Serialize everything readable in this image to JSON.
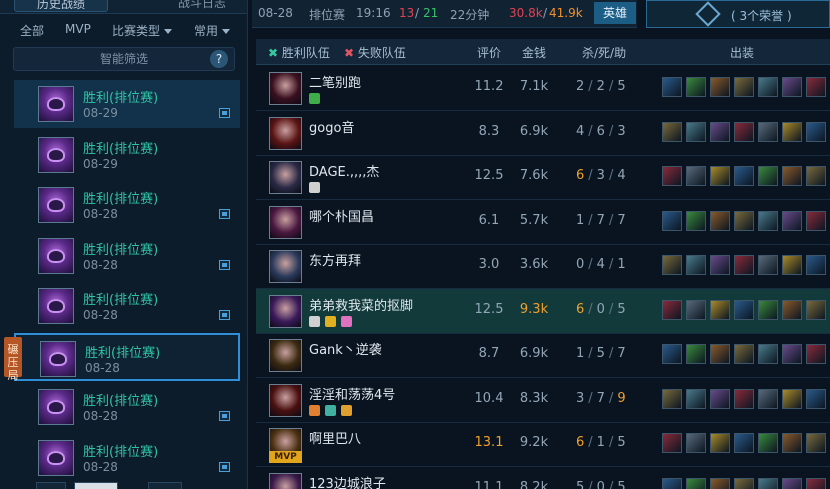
{
  "left": {
    "tab_active": "历史战绩",
    "tab_other": "战斗日志",
    "filters": [
      "全部",
      "MVP",
      "比赛类型",
      "常用"
    ],
    "smart_filter": "智能筛选",
    "help": "?",
    "crush_badge": "碾压局",
    "matches": [
      {
        "result": "胜利(排位赛)",
        "date": "08-29",
        "has_pic": true,
        "selected": true
      },
      {
        "result": "胜利(排位赛)",
        "date": "08-29",
        "has_pic": false
      },
      {
        "result": "胜利(排位赛)",
        "date": "08-28",
        "has_pic": true
      },
      {
        "result": "胜利(排位赛)",
        "date": "08-28",
        "has_pic": true
      },
      {
        "result": "胜利(排位赛)",
        "date": "08-28",
        "has_pic": true
      },
      {
        "result": "胜利(排位赛)",
        "date": "08-28",
        "has_pic": false,
        "highlighted": true
      },
      {
        "result": "胜利(排位赛)",
        "date": "08-28",
        "has_pic": true
      },
      {
        "result": "胜利(排位赛)",
        "date": "08-28",
        "has_pic": true
      }
    ]
  },
  "info": {
    "date": "08-28",
    "mode": "排位赛",
    "time": "19:16",
    "kills_red": "13",
    "slash": "/",
    "kills_green": "21",
    "duration": "22分钟",
    "gold_red": "30.8k",
    "gold_green": "41.9k",
    "hero_btn": "英雄",
    "honor": "( 3个荣誉 )"
  },
  "header": {
    "win_team": "胜利队伍",
    "lose_team": "失败队伍",
    "score": "评价",
    "gold": "金钱",
    "kda": "杀/死/助",
    "items": "出装"
  },
  "players": [
    {
      "name": "二笔别跑",
      "score": "11.2",
      "gold": "7.1k",
      "k": "2",
      "d": "2",
      "a": "5",
      "badges": [
        "#3fae4a"
      ],
      "ava": "#3a1020"
    },
    {
      "name": "gogo音",
      "score": "8.3",
      "gold": "6.9k",
      "k": "4",
      "d": "6",
      "a": "3",
      "badges": [],
      "ava": "#5a1414"
    },
    {
      "name": "DAGE.,,,,杰",
      "score": "12.5",
      "gold": "7.6k",
      "k": "6",
      "d": "3",
      "a": "4",
      "k_orange": true,
      "badges": [
        "#d0d0d0"
      ],
      "ava": "#2a2a46"
    },
    {
      "name": "哪个朴国昌",
      "score": "6.1",
      "gold": "5.7k",
      "k": "1",
      "d": "7",
      "a": "7",
      "badges": [],
      "ava": "#4a1840"
    },
    {
      "name": "东方再拜",
      "score": "3.0",
      "gold": "3.6k",
      "k": "0",
      "d": "4",
      "a": "1",
      "badges": [],
      "ava": "#2a3a5a"
    },
    {
      "name": "弟弟救我菜的抠脚",
      "score": "12.5",
      "gold": "9.3k",
      "k": "6",
      "d": "0",
      "a": "5",
      "k_orange": true,
      "gold_orange": true,
      "me": true,
      "badges": [
        "#d0d0d0",
        "#e0b020",
        "#e070c0"
      ],
      "ava": "#3a1a5a"
    },
    {
      "name": "Gank丶逆袭",
      "score": "8.7",
      "gold": "6.9k",
      "k": "1",
      "d": "5",
      "a": "7",
      "badges": [],
      "ava": "#3a2a10"
    },
    {
      "name": "淫淫和荡荡4号",
      "score": "10.4",
      "gold": "8.3k",
      "k": "3",
      "d": "7",
      "a": "9",
      "a_orange": true,
      "badges": [
        "#e08030",
        "#40b0a0",
        "#e0a030"
      ],
      "ava": "#4a1010"
    },
    {
      "name": "啊里巴八",
      "score": "13.1",
      "gold": "9.2k",
      "k": "6",
      "d": "1",
      "a": "5",
      "k_orange": true,
      "score_orange": true,
      "mvp": true,
      "mvp_label": "MVP",
      "badges": [],
      "ava": "#4a3010"
    },
    {
      "name": "123边城浪子",
      "score": "11.1",
      "gold": "8.2k",
      "k": "5",
      "d": "0",
      "a": "5",
      "badges": [],
      "ava": "#3a1a4a"
    }
  ]
}
